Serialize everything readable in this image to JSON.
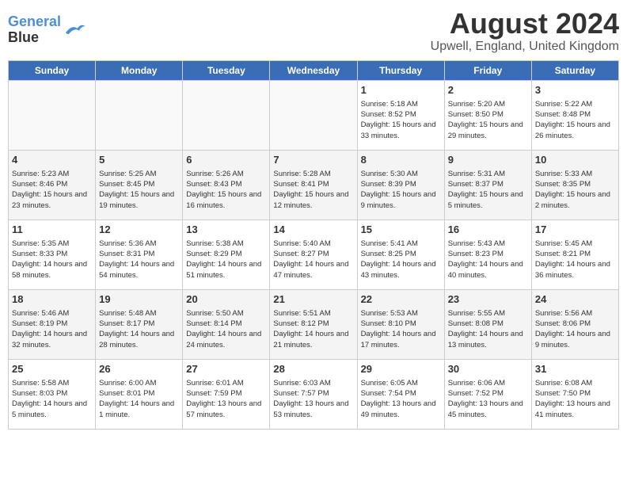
{
  "header": {
    "logo_line1": "General",
    "logo_line2": "Blue",
    "title": "August 2024",
    "subtitle": "Upwell, England, United Kingdom"
  },
  "days_of_week": [
    "Sunday",
    "Monday",
    "Tuesday",
    "Wednesday",
    "Thursday",
    "Friday",
    "Saturday"
  ],
  "weeks": [
    [
      {
        "day": "",
        "empty": true
      },
      {
        "day": "",
        "empty": true
      },
      {
        "day": "",
        "empty": true
      },
      {
        "day": "",
        "empty": true
      },
      {
        "day": "1",
        "sunrise": "5:18 AM",
        "sunset": "8:52 PM",
        "daylight": "15 hours and 33 minutes."
      },
      {
        "day": "2",
        "sunrise": "5:20 AM",
        "sunset": "8:50 PM",
        "daylight": "15 hours and 29 minutes."
      },
      {
        "day": "3",
        "sunrise": "5:22 AM",
        "sunset": "8:48 PM",
        "daylight": "15 hours and 26 minutes."
      }
    ],
    [
      {
        "day": "4",
        "sunrise": "5:23 AM",
        "sunset": "8:46 PM",
        "daylight": "15 hours and 23 minutes."
      },
      {
        "day": "5",
        "sunrise": "5:25 AM",
        "sunset": "8:45 PM",
        "daylight": "15 hours and 19 minutes."
      },
      {
        "day": "6",
        "sunrise": "5:26 AM",
        "sunset": "8:43 PM",
        "daylight": "15 hours and 16 minutes."
      },
      {
        "day": "7",
        "sunrise": "5:28 AM",
        "sunset": "8:41 PM",
        "daylight": "15 hours and 12 minutes."
      },
      {
        "day": "8",
        "sunrise": "5:30 AM",
        "sunset": "8:39 PM",
        "daylight": "15 hours and 9 minutes."
      },
      {
        "day": "9",
        "sunrise": "5:31 AM",
        "sunset": "8:37 PM",
        "daylight": "15 hours and 5 minutes."
      },
      {
        "day": "10",
        "sunrise": "5:33 AM",
        "sunset": "8:35 PM",
        "daylight": "15 hours and 2 minutes."
      }
    ],
    [
      {
        "day": "11",
        "sunrise": "5:35 AM",
        "sunset": "8:33 PM",
        "daylight": "14 hours and 58 minutes."
      },
      {
        "day": "12",
        "sunrise": "5:36 AM",
        "sunset": "8:31 PM",
        "daylight": "14 hours and 54 minutes."
      },
      {
        "day": "13",
        "sunrise": "5:38 AM",
        "sunset": "8:29 PM",
        "daylight": "14 hours and 51 minutes."
      },
      {
        "day": "14",
        "sunrise": "5:40 AM",
        "sunset": "8:27 PM",
        "daylight": "14 hours and 47 minutes."
      },
      {
        "day": "15",
        "sunrise": "5:41 AM",
        "sunset": "8:25 PM",
        "daylight": "14 hours and 43 minutes."
      },
      {
        "day": "16",
        "sunrise": "5:43 AM",
        "sunset": "8:23 PM",
        "daylight": "14 hours and 40 minutes."
      },
      {
        "day": "17",
        "sunrise": "5:45 AM",
        "sunset": "8:21 PM",
        "daylight": "14 hours and 36 minutes."
      }
    ],
    [
      {
        "day": "18",
        "sunrise": "5:46 AM",
        "sunset": "8:19 PM",
        "daylight": "14 hours and 32 minutes."
      },
      {
        "day": "19",
        "sunrise": "5:48 AM",
        "sunset": "8:17 PM",
        "daylight": "14 hours and 28 minutes."
      },
      {
        "day": "20",
        "sunrise": "5:50 AM",
        "sunset": "8:14 PM",
        "daylight": "14 hours and 24 minutes."
      },
      {
        "day": "21",
        "sunrise": "5:51 AM",
        "sunset": "8:12 PM",
        "daylight": "14 hours and 21 minutes."
      },
      {
        "day": "22",
        "sunrise": "5:53 AM",
        "sunset": "8:10 PM",
        "daylight": "14 hours and 17 minutes."
      },
      {
        "day": "23",
        "sunrise": "5:55 AM",
        "sunset": "8:08 PM",
        "daylight": "14 hours and 13 minutes."
      },
      {
        "day": "24",
        "sunrise": "5:56 AM",
        "sunset": "8:06 PM",
        "daylight": "14 hours and 9 minutes."
      }
    ],
    [
      {
        "day": "25",
        "sunrise": "5:58 AM",
        "sunset": "8:03 PM",
        "daylight": "14 hours and 5 minutes."
      },
      {
        "day": "26",
        "sunrise": "6:00 AM",
        "sunset": "8:01 PM",
        "daylight": "14 hours and 1 minute."
      },
      {
        "day": "27",
        "sunrise": "6:01 AM",
        "sunset": "7:59 PM",
        "daylight": "13 hours and 57 minutes."
      },
      {
        "day": "28",
        "sunrise": "6:03 AM",
        "sunset": "7:57 PM",
        "daylight": "13 hours and 53 minutes."
      },
      {
        "day": "29",
        "sunrise": "6:05 AM",
        "sunset": "7:54 PM",
        "daylight": "13 hours and 49 minutes."
      },
      {
        "day": "30",
        "sunrise": "6:06 AM",
        "sunset": "7:52 PM",
        "daylight": "13 hours and 45 minutes."
      },
      {
        "day": "31",
        "sunrise": "6:08 AM",
        "sunset": "7:50 PM",
        "daylight": "13 hours and 41 minutes."
      }
    ]
  ],
  "labels": {
    "sunrise_prefix": "Sunrise: ",
    "sunset_prefix": "Sunset: ",
    "daylight_prefix": "Daylight: "
  }
}
